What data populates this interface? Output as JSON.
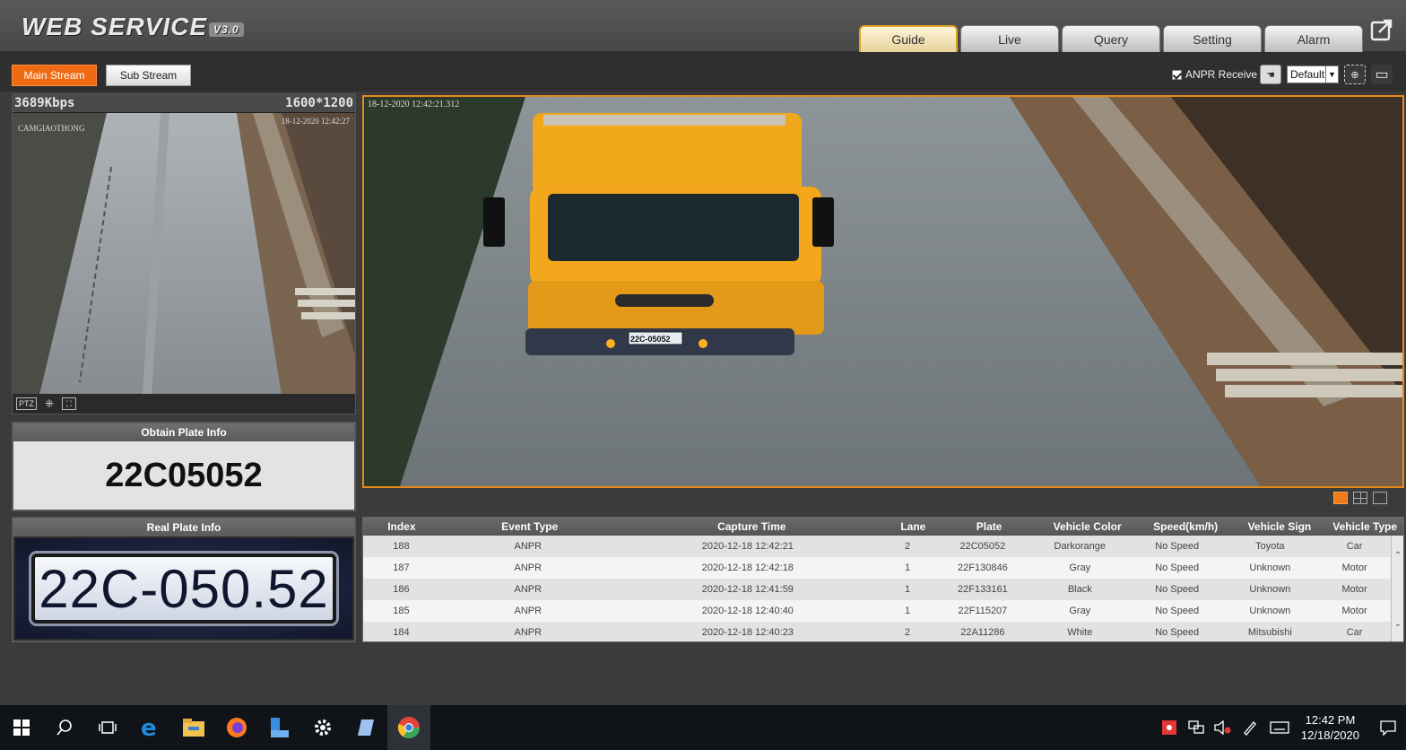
{
  "app": {
    "logo_text": "WEB  SERVICE",
    "logo_version": "V3.0"
  },
  "nav": {
    "tabs": [
      {
        "label": "Guide",
        "active": true
      },
      {
        "label": "Live",
        "active": false
      },
      {
        "label": "Query",
        "active": false
      },
      {
        "label": "Setting",
        "active": false
      },
      {
        "label": "Alarm",
        "active": false
      }
    ]
  },
  "stream": {
    "main_label": "Main Stream",
    "sub_label": "Sub Stream"
  },
  "toolbar": {
    "anpr_label": "ANPR Receive",
    "anpr_checked": true,
    "preset_value": "Default"
  },
  "preview": {
    "bitrate": "3689Kbps",
    "resolution": "1600*1200",
    "camera_label": "CAMGIAOTHONG",
    "timestamp": "18-12-2020 12:42:27",
    "ptz_label": "PTZ"
  },
  "main_video": {
    "timestamp": "18-12-2020 12:42:21.312",
    "plate_on_truck": "22C-05052"
  },
  "obtain_plate": {
    "title": "Obtain Plate Info",
    "value": "22C05052"
  },
  "real_plate": {
    "title": "Real Plate Info",
    "value": "22C-050.52"
  },
  "table": {
    "headers": [
      "Index",
      "Event Type",
      "Capture Time",
      "Lane",
      "Plate",
      "Vehicle Color",
      "Speed(km/h)",
      "Vehicle Sign",
      "Vehicle Type"
    ],
    "rows": [
      [
        "188",
        "ANPR",
        "2020-12-18 12:42:21",
        "2",
        "22C05052",
        "Darkorange",
        "No Speed",
        "Toyota",
        "Car"
      ],
      [
        "187",
        "ANPR",
        "2020-12-18 12:42:18",
        "1",
        "22F130846",
        "Gray",
        "No Speed",
        "Unknown",
        "Motor"
      ],
      [
        "186",
        "ANPR",
        "2020-12-18 12:41:59",
        "1",
        "22F133161",
        "Black",
        "No Speed",
        "Unknown",
        "Motor"
      ],
      [
        "185",
        "ANPR",
        "2020-12-18 12:40:40",
        "1",
        "22F115207",
        "Gray",
        "No Speed",
        "Unknown",
        "Motor"
      ],
      [
        "184",
        "ANPR",
        "2020-12-18 12:40:23",
        "2",
        "22A11286",
        "White",
        "No Speed",
        "Mitsubishi",
        "Car"
      ]
    ]
  },
  "taskbar": {
    "time": "12:42 PM",
    "date": "12/18/2020"
  },
  "colors": {
    "accent": "#f06a14",
    "active_tab_border": "#e0a320"
  }
}
